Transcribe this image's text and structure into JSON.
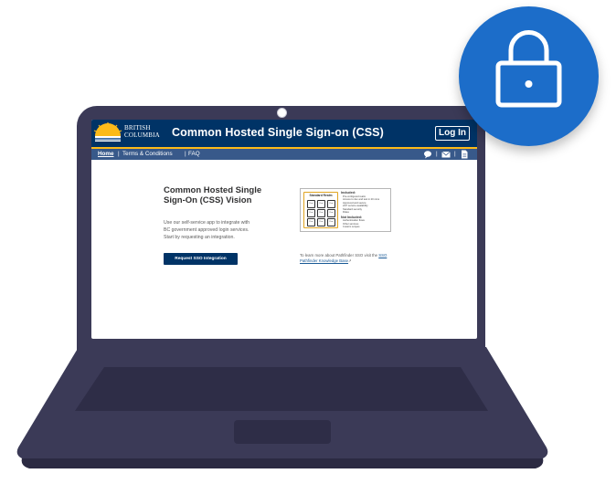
{
  "header": {
    "logo_line1": "BRITISH",
    "logo_line2": "COLUMBIA",
    "title": "Common Hosted Single Sign-on (CSS)",
    "login_label": "Log In"
  },
  "nav": {
    "items": [
      {
        "label": "Home",
        "active": true
      },
      {
        "label": "Terms & Conditions",
        "active": false
      },
      {
        "label": "FAQ",
        "active": false
      }
    ],
    "icons": [
      "chat-icon",
      "mail-icon",
      "document-icon"
    ]
  },
  "main": {
    "title": "Common Hosted Single Sign-On (CSS) Vision",
    "description": "Use our self-service app to integrate with BC government approved login services. Start by requesting an integration.",
    "request_button": "Request SSO Integration",
    "learn_more_text": "To learn more about Pathfinder SSO visit the",
    "learn_more_link": "SSO Pathfinder Knowledge Base",
    "diagram": {
      "standard_title": "Standard Realm",
      "cells": [
        "Prov",
        "Prov",
        "Prov",
        "Prov",
        "Prov",
        "Prov",
        "Prov",
        "Prov",
        "Prov"
      ],
      "included_heading": "Included:",
      "included": [
        "Pre-configured realm",
        "Access to dev and test in 20 mins",
        "Approved and secure",
        "24/7 service availability",
        "Standard security",
        "Roles"
      ],
      "not_included_heading": "Not Included:",
      "not_included": [
        "Authentication flows",
        "Other services",
        "Custom scopes"
      ]
    }
  },
  "colors": {
    "bc_blue": "#003366",
    "bc_gold": "#fcba19",
    "nav_blue": "#38598a",
    "laptop": "#3b3a57",
    "badge": "#1c6dc9"
  }
}
